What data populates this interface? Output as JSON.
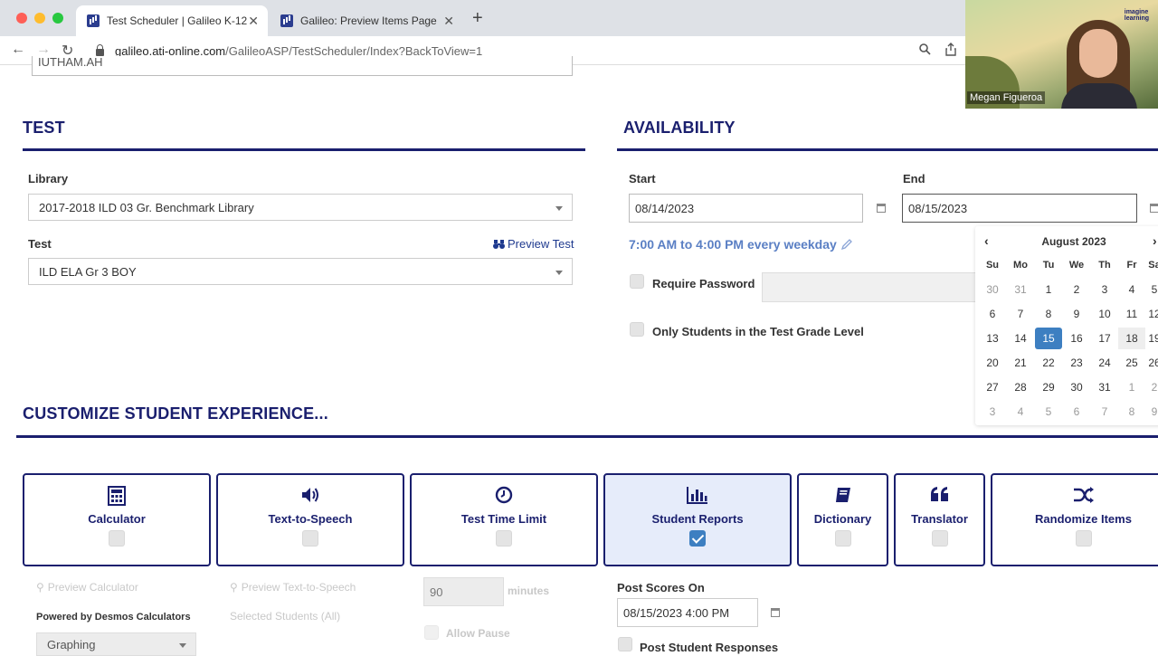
{
  "browser": {
    "tabs": [
      {
        "title": "Test Scheduler | Galileo K-12",
        "close": "✕"
      },
      {
        "title": "Galileo: Preview Items Page",
        "close": "✕"
      }
    ],
    "new_tab": "+",
    "url_host": "galileo.ati-online.com",
    "url_path": "/GalileoASP/TestScheduler/Index?BackToView=1"
  },
  "video": {
    "participant_name": "Megan Figueroa",
    "brand_line1": "imagine",
    "brand_line2": "learning"
  },
  "top_field": {
    "partial_value": "IUTHAM.AH"
  },
  "test_section": {
    "title": "TEST",
    "library_label": "Library",
    "library_value": "2017-2018 ILD 03 Gr. Benchmark Library",
    "test_label": "Test",
    "preview_test_link": "Preview Test",
    "test_value": "ILD ELA Gr 3 BOY"
  },
  "availability": {
    "title": "AVAILABILITY",
    "start_label": "Start",
    "start_value": "08/14/2023",
    "end_label": "End",
    "end_value": "08/15/2023",
    "schedule_text": "7:00 AM to 4:00 PM every weekday",
    "require_password_label": "Require Password",
    "only_grade_label": "Only Students in the Test Grade Level"
  },
  "calendar": {
    "month_label": "August 2023",
    "prev": "‹",
    "next": "›",
    "weekdays": [
      "Su",
      "Mo",
      "Tu",
      "We",
      "Th",
      "Fr",
      "Sa"
    ],
    "weeks": [
      [
        "30",
        "31",
        "1",
        "2",
        "3",
        "4",
        "5"
      ],
      [
        "6",
        "7",
        "8",
        "9",
        "10",
        "11",
        "12"
      ],
      [
        "13",
        "14",
        "15",
        "16",
        "17",
        "18",
        "19"
      ],
      [
        "20",
        "21",
        "22",
        "23",
        "24",
        "25",
        "26"
      ],
      [
        "27",
        "28",
        "29",
        "30",
        "31",
        "1",
        "2"
      ],
      [
        "3",
        "4",
        "5",
        "6",
        "7",
        "8",
        "9"
      ]
    ],
    "selected_day": "15",
    "hover_day": "18",
    "selected_color": "#3d7fc1"
  },
  "customize": {
    "title": "CUSTOMIZE STUDENT EXPERIENCE...",
    "cards": [
      {
        "label": "Calculator",
        "icon": "calculator-icon",
        "checked": false
      },
      {
        "label": "Text-to-Speech",
        "icon": "speaker-icon",
        "checked": false
      },
      {
        "label": "Test Time Limit",
        "icon": "clock-icon",
        "checked": false
      },
      {
        "label": "Student Reports",
        "icon": "bar-chart-icon",
        "checked": true
      },
      {
        "label": "Dictionary",
        "icon": "book-icon",
        "checked": false
      },
      {
        "label": "Translator",
        "icon": "quote-icon",
        "checked": false
      },
      {
        "label": "Randomize Items",
        "icon": "shuffle-icon",
        "checked": false
      }
    ]
  },
  "options": {
    "preview_calculator": "Preview Calculator",
    "powered_by": "Powered by Desmos Calculators",
    "calculator_mode": "Graphing",
    "preview_tts": "Preview Text-to-Speech",
    "selected_students": "Selected Students (All)",
    "time_limit_value": "90",
    "time_limit_unit": "minutes",
    "allow_pause": "Allow Pause",
    "post_scores_label": "Post Scores On",
    "post_scores_value": "08/15/2023 4:00 PM",
    "post_responses": "Post Student Responses"
  },
  "colors": {
    "brand_navy": "#1a1f6e",
    "link_blue": "#1f3a8f",
    "schedule_blue": "#5a7fc4",
    "active_card_bg": "#e6ecfa"
  }
}
